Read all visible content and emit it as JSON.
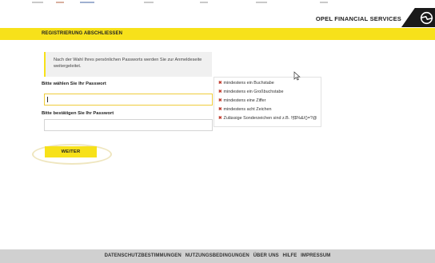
{
  "header": {
    "brand": "OPEL FINANCIAL SERVICES",
    "logo_icon": "opel-blitz-icon"
  },
  "banner": {
    "title": "REGISTRIERUNG ABSCHLIESSEN"
  },
  "info": {
    "text": "Nach der Wahl Ihres persönlichen Passworts werden Sie zur Anmeldeseite weitergeleitet."
  },
  "form": {
    "password_label": "Bitte wählen Sie Ihr Passwort",
    "password_value": "",
    "confirm_label": "Bitte bestätigen Sie Ihr Passwort",
    "confirm_value": "",
    "submit_label": "WEITER"
  },
  "requirements": [
    "mindestens ein Buchstabe",
    "mindestens ein Großbuchstabe",
    "mindestens eine Ziffer",
    "mindestens acht Zeichen",
    "Zulässige Sonderzeichen sind z.B. !§$%&/()=?@"
  ],
  "footer": {
    "links": [
      "DATENSCHUTZBESTIMMUNGEN",
      "NUTZUNGSBEDINGUNGEN",
      "ÜBER UNS",
      "HILFE",
      "IMPRESSUM"
    ]
  },
  "colors": {
    "accent": "#f7e11a",
    "error": "#c0392b",
    "footer": "#d0d0d0"
  }
}
